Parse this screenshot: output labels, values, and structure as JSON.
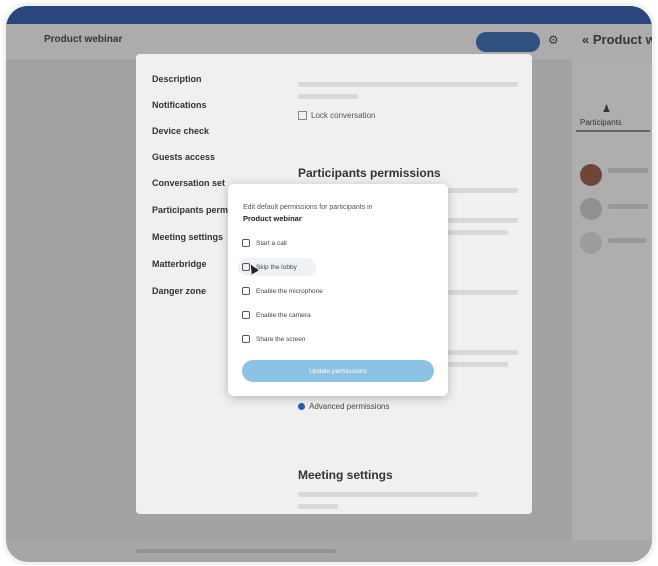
{
  "header": {
    "conversation_title": "Product webinar",
    "right_panel_title": "Product web"
  },
  "side_panel": {
    "tab_label": "Participants"
  },
  "settings_nav": {
    "items": [
      "Description",
      "Notifications",
      "Device check",
      "Guests access",
      "Conversation set",
      "Participants perm",
      "Meeting settings",
      "Matterbridge",
      "Danger zone"
    ]
  },
  "settings_content": {
    "lock_label": "Lock conversation",
    "participants_permissions_heading": "Participants permissions",
    "advanced_permissions_label": "Advanced permissions",
    "meeting_settings_heading": "Meeting settings"
  },
  "dialog": {
    "description": "Edit default permissions for participants in",
    "conversation_name": "Product webinar",
    "permissions": [
      {
        "label": "Start a call",
        "checked": false
      },
      {
        "label": "Skip the lobby",
        "checked": false
      },
      {
        "label": "Enable the microphone",
        "checked": false
      },
      {
        "label": "Enable the camera",
        "checked": false
      },
      {
        "label": "Share the screen",
        "checked": false
      }
    ],
    "update_button_label": "Update permissions"
  },
  "colors": {
    "primary": "#2a5fa8",
    "button_disabled": "#8cc2e4",
    "top_bar": "#1f4e9c"
  }
}
